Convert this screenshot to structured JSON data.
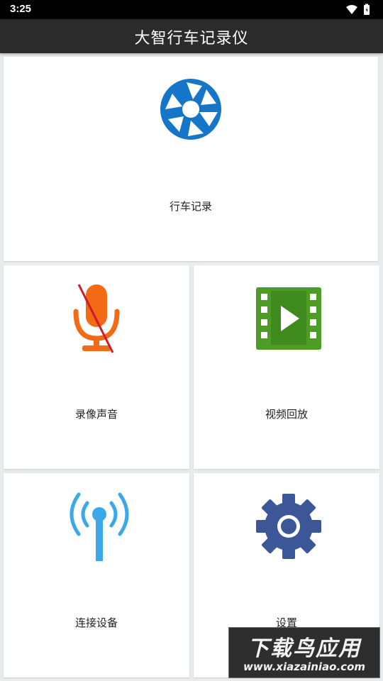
{
  "status_bar": {
    "time": "3:25",
    "icons": [
      "wifi-icon",
      "battery-icon"
    ]
  },
  "app_bar": {
    "title": "大智行车记录仪"
  },
  "tiles": {
    "record": {
      "label": "行车记录",
      "icon": "camera-shutter-icon",
      "color": "#1576c9"
    },
    "audio": {
      "label": "录像声音",
      "icon": "microphone-muted-icon",
      "color": "#f26a16"
    },
    "playback": {
      "label": "视频回放",
      "icon": "video-film-icon",
      "color": "#4c9c26"
    },
    "connect": {
      "label": "连接设备",
      "icon": "antenna-signal-icon",
      "color": "#3aa8e9"
    },
    "settings": {
      "label": "设置",
      "icon": "gear-icon",
      "color": "#3b5798"
    }
  },
  "watermark": {
    "title": "下载鸟应用",
    "url": "www.xiazainiao.com"
  }
}
